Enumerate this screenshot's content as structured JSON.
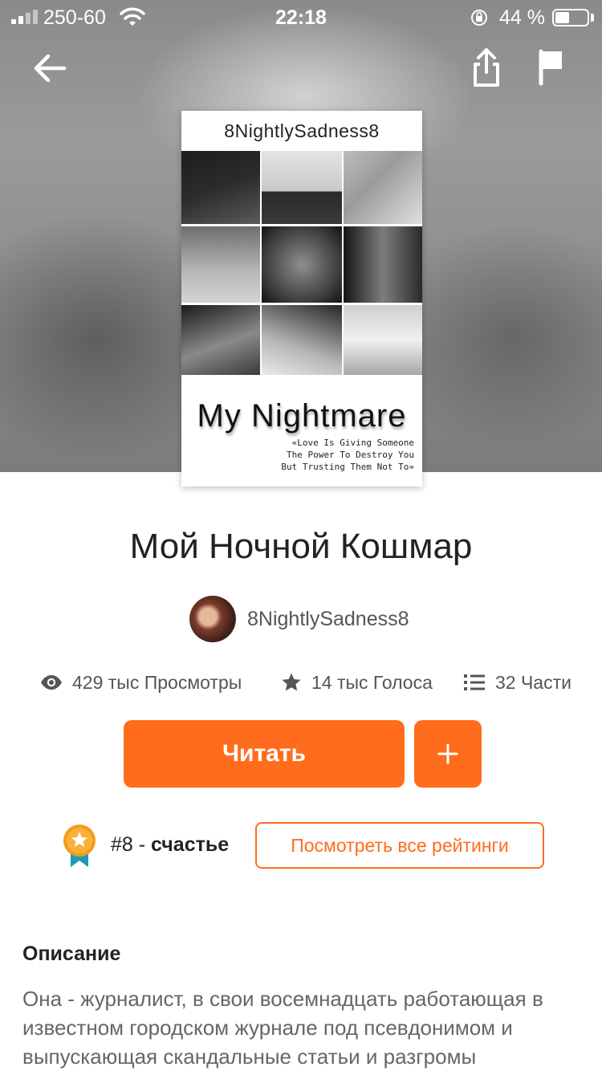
{
  "status_bar": {
    "carrier": "250-60",
    "time": "22:18",
    "battery_percent": "44 %",
    "battery_level": 0.44,
    "icons": [
      "signal-icon",
      "wifi-icon",
      "orientation-lock-icon",
      "battery-icon"
    ]
  },
  "nav": {
    "icons": [
      "back-arrow-icon",
      "share-icon",
      "flag-icon"
    ]
  },
  "cover": {
    "author": "8NightlySadness8",
    "title": "My Nightmare",
    "quote_line1": "«Love Is Giving Someone",
    "quote_line2": "The Power To Destroy You",
    "quote_line3": "But Trusting Them Not To»"
  },
  "book": {
    "title": "Мой Ночной Кошмар",
    "author": "8NightlySadness8"
  },
  "stats": {
    "views": "429 тыс Просмотры",
    "votes": "14 тыс Голоса",
    "parts": "32 Части"
  },
  "actions": {
    "read_label": "Читать",
    "add_label": "+"
  },
  "ranking": {
    "rank": "#8",
    "separator": " - ",
    "tag": "счастье",
    "view_all_label": "Посмотреть все рейтинги"
  },
  "description": {
    "heading": "Описание",
    "text": "Она - журналист, в свои восемнадцать работающая в известном городском журнале под псевдонимом и выпускающая скандальные статьи и разгромы"
  },
  "colors": {
    "accent": "#ff6d1c",
    "text_dark": "#222222",
    "text_muted": "#555555"
  }
}
